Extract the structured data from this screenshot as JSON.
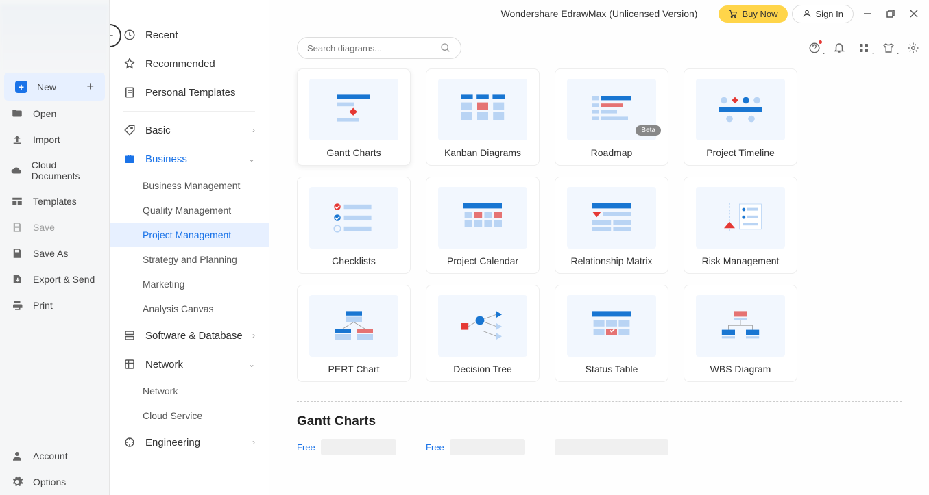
{
  "titlebar": {
    "title": "Wondershare EdrawMax (Unlicensed Version)",
    "buy": "Buy Now",
    "signin": "Sign In"
  },
  "search": {
    "placeholder": "Search diagrams..."
  },
  "sidebar1": {
    "new": "New",
    "open": "Open",
    "import": "Import",
    "cloud": "Cloud Documents",
    "templates": "Templates",
    "save": "Save",
    "saveas": "Save As",
    "export": "Export & Send",
    "print": "Print",
    "account": "Account",
    "options": "Options"
  },
  "categories": {
    "recent": "Recent",
    "recommended": "Recommended",
    "personal": "Personal Templates",
    "basic": "Basic",
    "business": "Business",
    "software": "Software & Database",
    "network": "Network",
    "engineering": "Engineering"
  },
  "business_subs": {
    "bm": "Business Management",
    "qm": "Quality Management",
    "pm": "Project Management",
    "sp": "Strategy and Planning",
    "mk": "Marketing",
    "ac": "Analysis Canvas"
  },
  "network_subs": {
    "net": "Network",
    "cloud": "Cloud Service"
  },
  "cards": {
    "gantt": "Gantt Charts",
    "kanban": "Kanban Diagrams",
    "roadmap": "Roadmap",
    "roadmap_badge": "Beta",
    "timeline": "Project Timeline",
    "checklists": "Checklists",
    "calendar": "Project Calendar",
    "relmatrix": "Relationship Matrix",
    "risk": "Risk Management",
    "pert": "PERT Chart",
    "dtree": "Decision Tree",
    "status": "Status Table",
    "wbs": "WBS Diagram"
  },
  "section": {
    "gantt_heading": "Gantt Charts",
    "free": "Free"
  }
}
